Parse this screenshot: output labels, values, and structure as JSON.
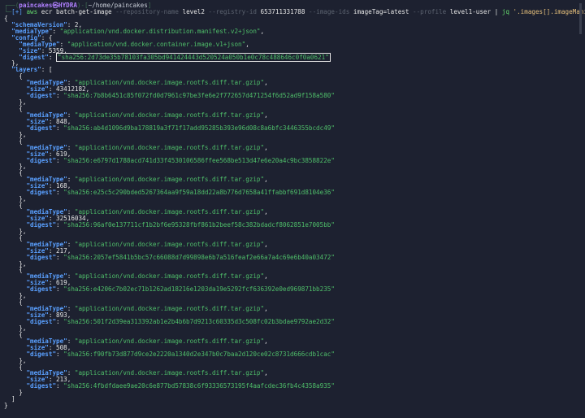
{
  "prompt": {
    "user": "paincakes㉿HYDRA",
    "path": "~/home/paincakes",
    "status": "[+]"
  },
  "command": {
    "program": "aws",
    "service": "ecr",
    "action": "batch-get-image",
    "args": [
      {
        "flag": "--repository-name",
        "value": "level2"
      },
      {
        "flag": "--registry-id",
        "value": "653711331788"
      },
      {
        "flag": "--image-ids",
        "value": "imageTag=latest"
      },
      {
        "flag": "--profile",
        "value": "level1-user"
      }
    ],
    "pipe1": "|",
    "jq": "jq",
    "jq_filter": "'.images[].imageManifest | fromjson'"
  },
  "manifest": {
    "schemaVersion": "2",
    "mediaType": "\"application/vnd.docker.distribution.manifest.v2+json\"",
    "config": {
      "mediaType": "\"application/vnd.docker.container.image.v1+json\"",
      "size": "5359",
      "digest": "\"sha256:2d73de35b78103fa305bd941424443d520524a050b1e0c78c488646c0f0a0621\""
    },
    "layers": [
      {
        "mediaType": "\"application/vnd.docker.image.rootfs.diff.tar.gzip\"",
        "size": "43412182",
        "digest": "\"sha256:7b8b6451c85f072fd0d7961c97be3fe6e2f772657d471254f6d52ad9f158a580\""
      },
      {
        "mediaType": "\"application/vnd.docker.image.rootfs.diff.tar.gzip\"",
        "size": "848",
        "digest": "\"sha256:ab4d1096d9ba178819a3f71f17add95285b393e96d08c8a6bfc3446355bcdc49\""
      },
      {
        "mediaType": "\"application/vnd.docker.image.rootfs.diff.tar.gzip\"",
        "size": "619",
        "digest": "\"sha256:e6797d1788acd741d33f4530106586ffee568be513d47e6e20a4c9bc3858822e\""
      },
      {
        "mediaType": "\"application/vnd.docker.image.rootfs.diff.tar.gzip\"",
        "size": "168",
        "digest": "\"sha256:e25c5c290bded5267364aa9f59a18dd22a8b776d7658a41ffabbf691d8104e36\""
      },
      {
        "mediaType": "\"application/vnd.docker.image.rootfs.diff.tar.gzip\"",
        "size": "32516034",
        "digest": "\"sha256:96af0e137711cf1b2bf6e95328fbf861b2beef58c382bdadcf8062851e7005bb\""
      },
      {
        "mediaType": "\"application/vnd.docker.image.rootfs.diff.tar.gzip\"",
        "size": "217",
        "digest": "\"sha256:2057ef5841b5bc57c66088d7d99898e6b7a516feaf2e66a7a4c69e6b40a03472\""
      },
      {
        "mediaType": "\"application/vnd.docker.image.rootfs.diff.tar.gzip\"",
        "size": "619",
        "digest": "\"sha256:e4206c7b02ec71b1262ad18216e1203da19e5292fcf636392e0ed969871bb235\""
      },
      {
        "mediaType": "\"application/vnd.docker.image.rootfs.diff.tar.gzip\"",
        "size": "893",
        "digest": "\"sha256:501f2d39ea313392ab1e2b4b6b7d9213c60335d3c508fc02b3bdae9792ae2d32\""
      },
      {
        "mediaType": "\"application/vnd.docker.image.rootfs.diff.tar.gzip\"",
        "size": "508",
        "digest": "\"sha256:f90fb73d877d9ce2e2220a1340d2e347b0c7baa2d120ce02c8731d666cdb1cac\""
      },
      {
        "mediaType": "\"application/vnd.docker.image.rootfs.diff.tar.gzip\"",
        "size": "213",
        "digest": "\"sha256:4fbdfdaee9ae20c6e877bd57838c6f93336573195f4aafcdec36fb4c4358a935\""
      }
    ]
  },
  "keys": {
    "schemaVersion": "\"schemaVersion\"",
    "mediaType": "\"mediaType\"",
    "config": "\"config\"",
    "size": "\"size\"",
    "digest": "\"digest\"",
    "layers": "\"layers\""
  },
  "colors": {
    "background": "#1d2130",
    "key": "#5aa0ff",
    "string": "#4fbf6a",
    "prompt_user": "#b080ff"
  }
}
